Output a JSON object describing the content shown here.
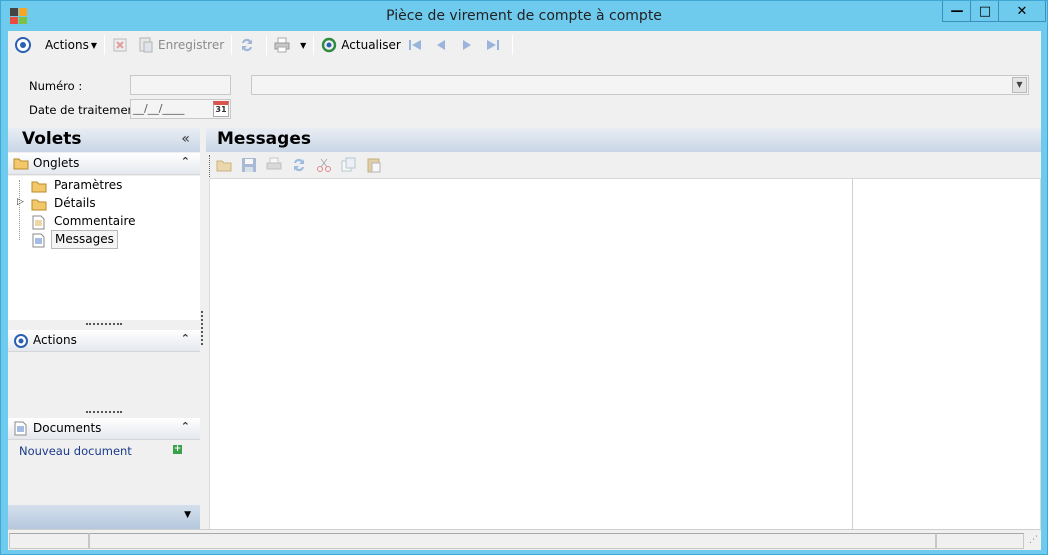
{
  "window": {
    "title": "Pièce de virement de compte à compte",
    "controls": {
      "minimize": "—",
      "maximize": "□",
      "close": "✕"
    }
  },
  "toolbar": {
    "actions_label": "Actions",
    "save_label": "Enregistrer",
    "refresh_label": "Actualiser"
  },
  "form": {
    "numero_label": "Numéro :",
    "numero_value": "",
    "date_label": "Date de traitement :",
    "date_value": "__/__/____",
    "calendar_day": "31"
  },
  "volets": {
    "title": "Volets",
    "collapse": "«",
    "onglets": {
      "title": "Onglets",
      "items": [
        {
          "label": "Paramètres",
          "icon": "folder-icon"
        },
        {
          "label": "Détails",
          "icon": "folder-icon",
          "expandable": true
        },
        {
          "label": "Commentaire",
          "icon": "document-icon"
        },
        {
          "label": "Messages",
          "icon": "document-icon",
          "selected": true
        }
      ]
    },
    "actions": {
      "title": "Actions"
    },
    "documents": {
      "title": "Documents",
      "new_link": "Nouveau document"
    }
  },
  "main": {
    "title": "Messages"
  },
  "colors": {
    "titlebar": "#6fcbee",
    "header_gradient_end": "#c8d6e6",
    "link": "#1a3a8a"
  }
}
